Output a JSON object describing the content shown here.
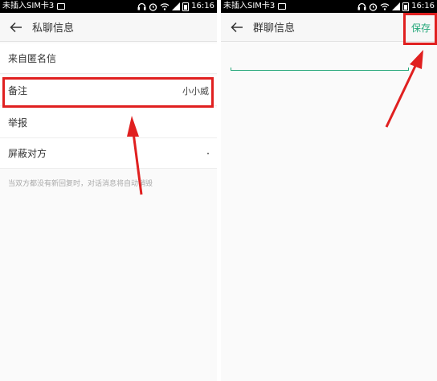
{
  "status_bar": {
    "carrier": "未插入SIM卡3",
    "time": "16:16"
  },
  "left_screen": {
    "title": "私聊信息",
    "rows": [
      {
        "label": "来自匿名信"
      },
      {
        "label": "备注",
        "value": "小小威"
      },
      {
        "label": "举报"
      },
      {
        "label": "屏蔽对方"
      }
    ],
    "hint": "当双方都没有新回复时，对话消息将自动销毁"
  },
  "right_screen": {
    "title": "群聊信息",
    "save_label": "保存",
    "input_value": ""
  },
  "colors": {
    "accent_green": "#25a77a",
    "highlight_red": "#e02020"
  },
  "icons": [
    "back-arrow-icon",
    "headphones-icon",
    "alarm-icon",
    "wifi-icon",
    "signal-icon",
    "battery-icon",
    "notification-icon"
  ]
}
